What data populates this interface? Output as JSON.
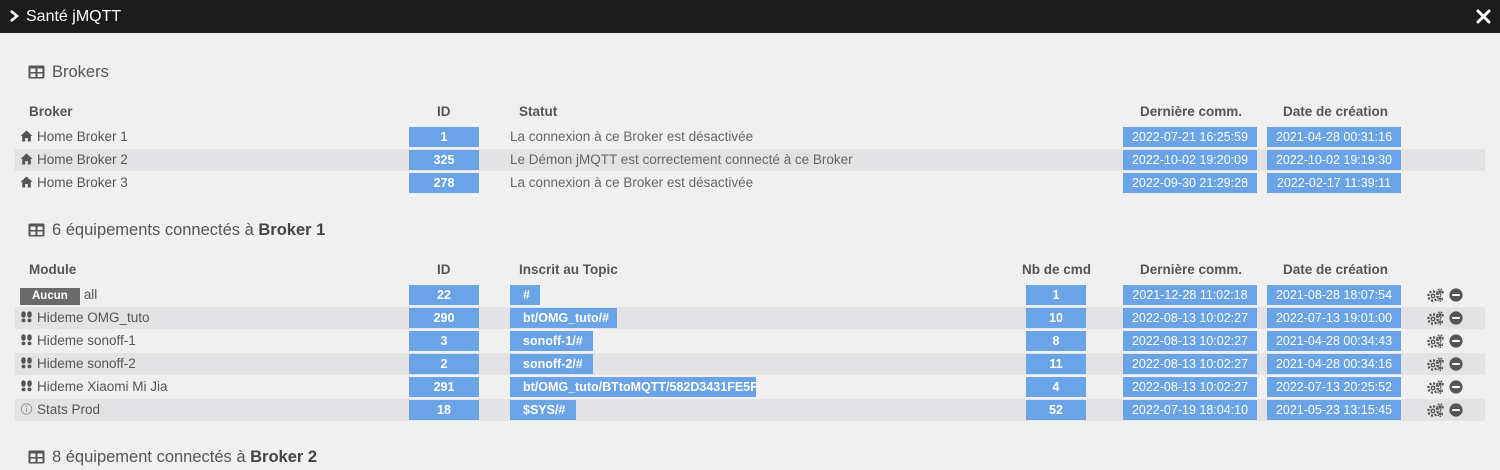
{
  "window": {
    "title": "Santé jMQTT"
  },
  "brokers_section": {
    "title": "Brokers"
  },
  "brokers_table": {
    "headers": {
      "broker": "Broker",
      "id": "ID",
      "statut": "Statut",
      "derniere": "Dernière comm.",
      "creation": "Date de création"
    },
    "rows": [
      {
        "name": "Home Broker 1",
        "id": "1",
        "statut": "La connexion à ce Broker est désactivée",
        "derniere": "2022-07-21 16:25:59",
        "creation": "2021-04-28 00:31:16"
      },
      {
        "name": "Home Broker 2",
        "id": "325",
        "statut": "Le Démon jMQTT est correctement connecté à ce Broker",
        "derniere": "2022-10-02 19:20:09",
        "creation": "2022-10-02 19:19:30"
      },
      {
        "name": "Home Broker 3",
        "id": "278",
        "statut": "La connexion à ce Broker est désactivée",
        "derniere": "2022-09-30 21:29:28",
        "creation": "2022-02-17 11:39:11"
      }
    ]
  },
  "broker1_section": {
    "prefix": "6 équipements connectés à ",
    "broker": "Broker 1"
  },
  "equip_table": {
    "headers": {
      "module": "Module",
      "id": "ID",
      "topic": "Inscrit au Topic",
      "nbcmd": "Nb de cmd",
      "derniere": "Dernière comm.",
      "creation": "Date de création"
    },
    "rows": [
      {
        "tag": "Aucun",
        "name": "all",
        "id": "22",
        "topic": "#",
        "nbcmd": "1",
        "derniere": "2021-12-28 11:02:18",
        "creation": "2021-08-28 18:07:54"
      },
      {
        "icon": "footprints-icon",
        "name": "Hideme OMG_tuto",
        "id": "290",
        "topic": "bt/OMG_tuto/#",
        "nbcmd": "10",
        "derniere": "2022-08-13 10:02:27",
        "creation": "2022-07-13 19:01:00"
      },
      {
        "icon": "footprints-icon",
        "name": "Hideme sonoff-1",
        "id": "3",
        "topic": "sonoff-1/#",
        "nbcmd": "8",
        "derniere": "2022-08-13 10:02:27",
        "creation": "2021-04-28 00:34:43"
      },
      {
        "icon": "footprints-icon",
        "name": "Hideme sonoff-2",
        "id": "2",
        "topic": "sonoff-2/#",
        "nbcmd": "11",
        "derniere": "2022-08-13 10:02:27",
        "creation": "2021-04-28 00:34:16"
      },
      {
        "icon": "footprints-icon",
        "name": "Hideme Xiaomi Mi Jia",
        "id": "291",
        "topic": "bt/OMG_tuto/BTtoMQTT/582D3431FE5F",
        "nbcmd": "4",
        "derniere": "2022-08-13 10:02:27",
        "creation": "2022-07-13 20:25:52"
      },
      {
        "icon": "info-icon",
        "name": "Stats Prod",
        "id": "18",
        "topic": "$SYS/#",
        "nbcmd": "52",
        "derniere": "2022-07-19 18:04:10",
        "creation": "2021-05-23 13:15:45"
      }
    ]
  },
  "broker2_section": {
    "prefix": "8 équipement connectés à ",
    "broker": "Broker 2"
  },
  "colors": {
    "badge": "#6aa3e6",
    "titlebar": "#1c1c1c",
    "tag": "#6a6a6a",
    "alt_row": "#e3e3e5"
  }
}
